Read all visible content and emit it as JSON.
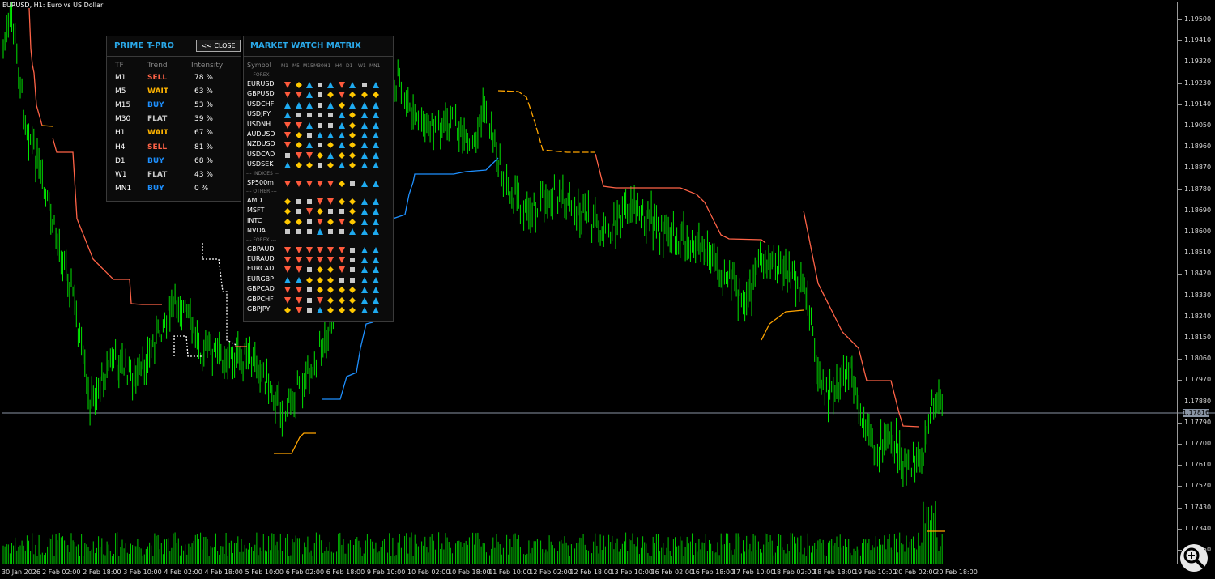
{
  "window": {
    "title": "EURUSD, H1:  Euro vs US Dollar"
  },
  "colors": {
    "up_candle": "#00e600",
    "down_candle": "#00e600",
    "sell": "#ff6347",
    "buy": "#1e90ff",
    "wait": "#ffa500",
    "flat": "#c8c8c8",
    "panel_accent": "#2aa8e8"
  },
  "price_axis": {
    "ticks": [
      "1.19500",
      "1.19410",
      "1.19320",
      "1.19230",
      "1.19140",
      "1.19050",
      "1.18960",
      "1.18870",
      "1.18780",
      "1.18690",
      "1.18600",
      "1.18510",
      "1.18420",
      "1.18330",
      "1.18240",
      "1.18150",
      "1.18060",
      "1.17970",
      "1.17880",
      "1.17790",
      "1.17700",
      "1.17610",
      "1.17520",
      "1.17430",
      "1.17340",
      "1.17250"
    ],
    "current_price": "1.17816"
  },
  "time_axis": {
    "ticks": [
      "30 Jan 2026",
      "2 Feb 02:00",
      "2 Feb 18:00",
      "3 Feb 10:00",
      "4 Feb 02:00",
      "4 Feb 18:00",
      "5 Feb 10:00",
      "6 Feb 02:00",
      "6 Feb 18:00",
      "9 Feb 10:00",
      "10 Feb 02:00",
      "10 Feb 18:00",
      "11 Feb 10:00",
      "12 Feb 02:00",
      "12 Feb 18:00",
      "13 Feb 10:00",
      "16 Feb 02:00",
      "16 Feb 18:00",
      "17 Feb 10:00",
      "18 Feb 02:00",
      "18 Feb 18:00",
      "19 Feb 10:00",
      "20 Feb 02:00",
      "20 Feb 18:00"
    ]
  },
  "prime_panel": {
    "title": "PRIME T-PRO",
    "close_label": "<< CLOSE",
    "headers": {
      "tf": "TF",
      "trend": "Trend",
      "intensity": "Intensity"
    },
    "rows": [
      {
        "tf": "M1",
        "trend": "SELL",
        "intensity": "78 %"
      },
      {
        "tf": "M5",
        "trend": "WAIT",
        "intensity": "63 %"
      },
      {
        "tf": "M15",
        "trend": "BUY",
        "intensity": "53 %"
      },
      {
        "tf": "M30",
        "trend": "FLAT",
        "intensity": "39 %"
      },
      {
        "tf": "H1",
        "trend": "WAIT",
        "intensity": "67 %"
      },
      {
        "tf": "H4",
        "trend": "SELL",
        "intensity": "81 %"
      },
      {
        "tf": "D1",
        "trend": "BUY",
        "intensity": "68 %"
      },
      {
        "tf": "W1",
        "trend": "FLAT",
        "intensity": "43 %"
      },
      {
        "tf": "MN1",
        "trend": "BUY",
        "intensity": "0 %"
      }
    ]
  },
  "matrix_panel": {
    "title": "MARKET WATCH MATRIX",
    "symbol_header": "Symbol",
    "timeframes": [
      "M1",
      "M5",
      "M15",
      "M30",
      "H1",
      "H4",
      "D1",
      "W1",
      "MN1"
    ],
    "sections": [
      {
        "label": "--- FOREX ---",
        "rows": [
          {
            "symbol": "EURUSD",
            "signals": "dwusudusu"
          },
          {
            "symbol": "GBPUSD",
            "signals": "dduswdwww"
          },
          {
            "symbol": "USDCHF",
            "signals": "uuusuwuuu"
          },
          {
            "symbol": "USDJPY",
            "signals": "ussssuwuu"
          },
          {
            "symbol": "USDNH",
            "signals": "ddussuwuu"
          },
          {
            "symbol": "AUDUSD",
            "signals": "dwsuuuwuu"
          },
          {
            "symbol": "NZDUSD",
            "signals": "dwuswuwuu"
          },
          {
            "symbol": "USDCAD",
            "signals": "sddwuwwuu"
          },
          {
            "symbol": "USDSEK",
            "signals": "uwwswuwuu"
          }
        ]
      },
      {
        "label": "--- INDICES ---",
        "rows": [
          {
            "symbol": "SP500m",
            "signals": "dddddwsuu"
          }
        ]
      },
      {
        "label": "--- OTHER ---",
        "rows": [
          {
            "symbol": "AMD",
            "signals": "wssddwwuu"
          },
          {
            "symbol": "MSFT",
            "signals": "wsdwsswuu"
          },
          {
            "symbol": "INTC",
            "signals": "wwsdwdwuu"
          },
          {
            "symbol": "NVDA",
            "signals": "sssussuuu"
          }
        ]
      },
      {
        "label": "--- FOREX ---",
        "rows": [
          {
            "symbol": "GBPAUD",
            "signals": "ddddddsuu"
          },
          {
            "symbol": "EURAUD",
            "signals": "ddddddsuu"
          },
          {
            "symbol": "EURCAD",
            "signals": "ddswwdsuu"
          },
          {
            "symbol": "EURGBP",
            "signals": "uuwwwssuu"
          },
          {
            "symbol": "GBPCAD",
            "signals": "ddswwwwuu"
          },
          {
            "symbol": "GBPCHF",
            "signals": "ddsdwwwuu"
          },
          {
            "symbol": "GBPJPY",
            "signals": "wdsuwwwuu"
          }
        ]
      }
    ]
  }
}
